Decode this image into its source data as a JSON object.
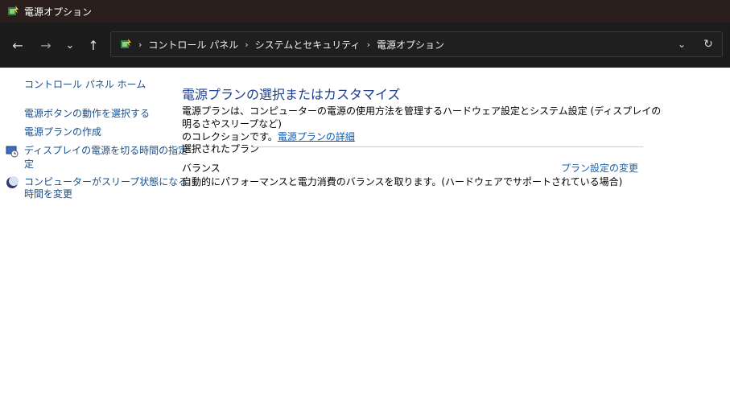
{
  "window": {
    "title": "電源オプション"
  },
  "nav": {
    "back_icon": "←",
    "forward_icon": "→",
    "recent_icon": "⌄",
    "up_icon": "↑"
  },
  "address": {
    "breadcrumbs": [
      "コントロール パネル",
      "システムとセキュリティ",
      "電源オプション"
    ],
    "separator": "›",
    "dropdown_icon": "⌄",
    "refresh_icon": "↻"
  },
  "sidebar": {
    "home": "コントロール パネル ホーム",
    "items": [
      {
        "label": "電源ボタンの動作を選択する"
      },
      {
        "label": "電源プランの作成"
      },
      {
        "label1": "ディスプレイの電源を切る時間の指定",
        "label2": "定",
        "icon": "clock-monitor-icon"
      },
      {
        "label1": "コンピューターがスリープ状態になる",
        "label2": "時間を変更",
        "icon": "moon-icon"
      }
    ]
  },
  "main": {
    "title": "電源プランの選択またはカスタマイズ",
    "desc_line1": "電源プランは、コンピューターの電源の使用方法を管理するハードウェア設定とシステム設定 (ディスプレイの明るさやスリープなど)",
    "desc_line2": "のコレクションです。",
    "desc_link": "電源プランの詳細",
    "group_label": "選択されたプラン",
    "plan": {
      "name": "バランス",
      "change_link": "プラン設定の変更",
      "description": "自動的にパフォーマンスと電力消費のバランスを取ります。(ハードウェアでサポートされている場合)"
    }
  },
  "colors": {
    "titlebar_bg": "#2a1f1c",
    "navbar_bg": "#1c1c1c",
    "link": "#1a4f8a",
    "title": "#1e3e8c"
  }
}
